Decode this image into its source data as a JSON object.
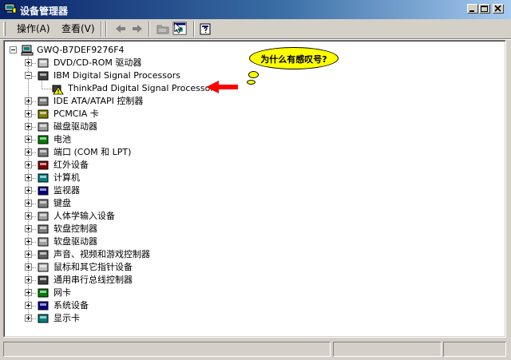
{
  "window": {
    "title": "设备管理器",
    "icon": "device-manager-icon"
  },
  "menu": {
    "action": "操作(A)",
    "view": "查看(V)"
  },
  "toolbar": {
    "buttons": [
      "back-arrow-icon",
      "forward-arrow-icon",
      "folder-icon",
      "properties-icon",
      "help-icon"
    ]
  },
  "tree": {
    "root": "GWQ-B7DEF9276F4",
    "items": [
      {
        "label": "DVD/CD-ROM 驱动器",
        "icon": "cdrom-icon",
        "expanded": false
      },
      {
        "label": "IBM Digital Signal Processors",
        "icon": "dsp-icon",
        "expanded": true,
        "children": [
          {
            "label": "ThinkPad Digital Signal Processor",
            "icon": "warning-device-icon"
          }
        ]
      },
      {
        "label": "IDE ATA/ATAPI 控制器",
        "icon": "ide-controller-icon",
        "expanded": false
      },
      {
        "label": "PCMCIA 卡",
        "icon": "pcmcia-icon",
        "expanded": false
      },
      {
        "label": "磁盘驱动器",
        "icon": "disk-drive-icon",
        "expanded": false
      },
      {
        "label": "电池",
        "icon": "battery-icon",
        "expanded": false
      },
      {
        "label": "端口 (COM 和 LPT)",
        "icon": "port-icon",
        "expanded": false
      },
      {
        "label": "红外设备",
        "icon": "infrared-icon",
        "expanded": false
      },
      {
        "label": "计算机",
        "icon": "computer-icon",
        "expanded": false
      },
      {
        "label": "监视器",
        "icon": "monitor-icon",
        "expanded": false
      },
      {
        "label": "键盘",
        "icon": "keyboard-icon",
        "expanded": false
      },
      {
        "label": "人体学输入设备",
        "icon": "hid-icon",
        "expanded": false
      },
      {
        "label": "软盘控制器",
        "icon": "floppy-controller-icon",
        "expanded": false
      },
      {
        "label": "软盘驱动器",
        "icon": "floppy-drive-icon",
        "expanded": false
      },
      {
        "label": "声音、视频和游戏控制器",
        "icon": "sound-icon",
        "expanded": false
      },
      {
        "label": "鼠标和其它指针设备",
        "icon": "mouse-icon",
        "expanded": false
      },
      {
        "label": "通用串行总线控制器",
        "icon": "usb-icon",
        "expanded": false
      },
      {
        "label": "网卡",
        "icon": "network-card-icon",
        "expanded": false
      },
      {
        "label": "系统设备",
        "icon": "system-device-icon",
        "expanded": false
      },
      {
        "label": "显示卡",
        "icon": "display-adapter-icon",
        "expanded": false
      }
    ]
  },
  "annotation": {
    "text": "为什么有感叹号?",
    "fill": "#ffff00",
    "arrow_color": "#ff0000"
  },
  "colors": {
    "titlebar_start": "#0a246a",
    "titlebar_end": "#a6caf0",
    "face": "#d4d0c8"
  }
}
